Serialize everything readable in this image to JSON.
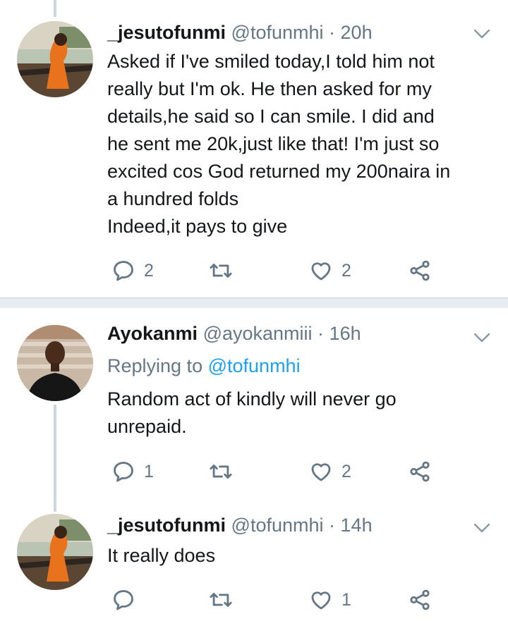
{
  "tweets": [
    {
      "display_name": "_jesutofunmi",
      "handle": "@tofunmhi",
      "separator": "·",
      "time": "20h",
      "text": "Asked if I've smiled today,I told him not\nreally but I'm ok. He then asked for my\ndetails,he said so I can smile. I did and\nhe sent me 20k,just like that! I'm just so\nexcited cos God returned my 200naira in\na hundred folds\nIndeed,it pays to give",
      "replies": "2",
      "retweets": "",
      "likes": "2"
    },
    {
      "display_name": "Ayokanmi",
      "handle": "@ayokanmiii",
      "separator": "·",
      "time": "16h",
      "replying_label": "Replying to",
      "replying_to": "@tofunmhi",
      "text": "Random act of kindly will never go\nunrepaid.",
      "replies": "1",
      "retweets": "",
      "likes": "2"
    },
    {
      "display_name": "_jesutofunmi",
      "handle": "@tofunmhi",
      "separator": "·",
      "time": "14h",
      "text": "It really does",
      "replies": "",
      "retweets": "",
      "likes": "1"
    }
  ],
  "icons": {
    "reply": "reply-icon",
    "retweet": "retweet-icon",
    "like": "heart-icon",
    "share": "share-icon",
    "menu": "chevron-down-icon"
  },
  "colors": {
    "text": "#14171a",
    "secondary": "#657786",
    "link": "#1da1f2",
    "divider": "#e6ecf0",
    "thread_line": "#ccd6dd"
  }
}
